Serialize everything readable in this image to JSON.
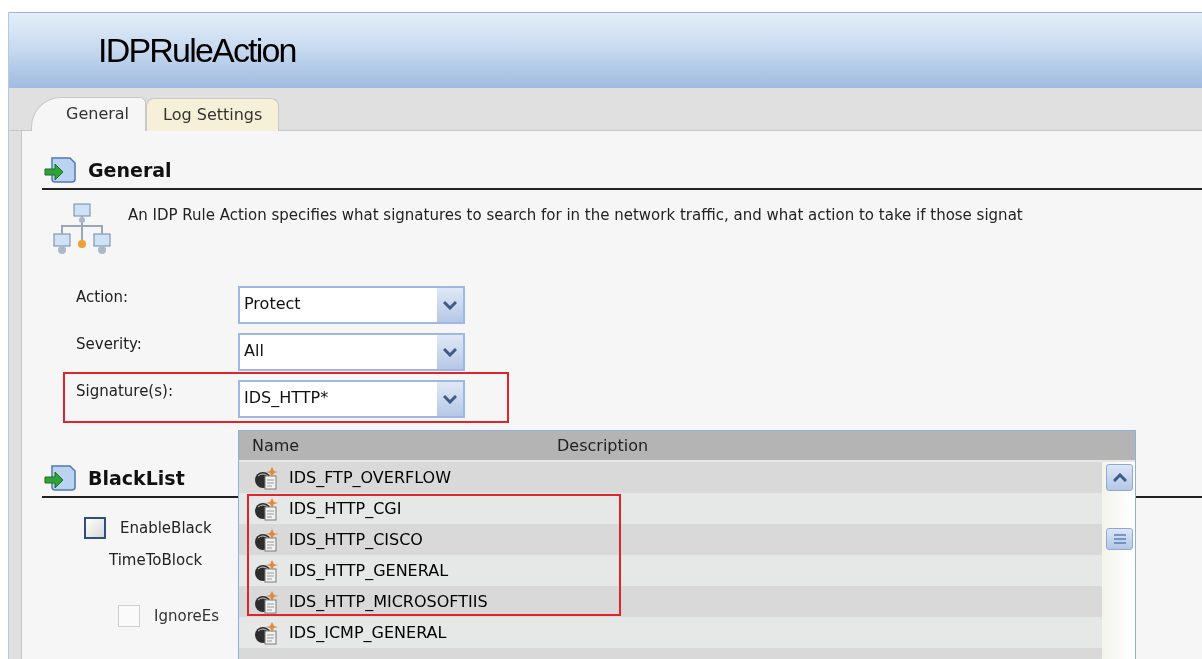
{
  "title": "IDPRuleAction",
  "tabs": [
    {
      "label": "General",
      "selected": true
    },
    {
      "label": "Log Settings",
      "selected": false
    }
  ],
  "general_section": {
    "heading": "General",
    "description": "An IDP Rule Action specifies what signatures to search for in the network traffic, and what action to take if those signat",
    "fields": [
      {
        "label": "Action:",
        "value": "Protect",
        "highlighted": false
      },
      {
        "label": "Severity:",
        "value": "All",
        "highlighted": false
      },
      {
        "label": "Signature(s):",
        "value": "IDS_HTTP*",
        "highlighted": true
      }
    ]
  },
  "blacklist_section": {
    "heading": "BlackList",
    "options": [
      {
        "kind": "checkbox",
        "label": "EnableBlack",
        "checked": false,
        "disabled": false
      },
      {
        "kind": "text",
        "label": "TimeToBlock"
      },
      {
        "kind": "checkbox",
        "label": "IgnoreEs",
        "checked": false,
        "disabled": true
      }
    ]
  },
  "signature_dropdown": {
    "columns": [
      "Name",
      "Description"
    ],
    "rows": [
      {
        "name": "IDS_FTP_OVERFLOW",
        "highlighted": false
      },
      {
        "name": "IDS_HTTP_CGI",
        "highlighted": true
      },
      {
        "name": "IDS_HTTP_CISCO",
        "highlighted": true
      },
      {
        "name": "IDS_HTTP_GENERAL",
        "highlighted": true
      },
      {
        "name": "IDS_HTTP_MICROSOFTIIS",
        "highlighted": true
      },
      {
        "name": "IDS_ICMP_GENERAL",
        "highlighted": false
      }
    ]
  }
}
